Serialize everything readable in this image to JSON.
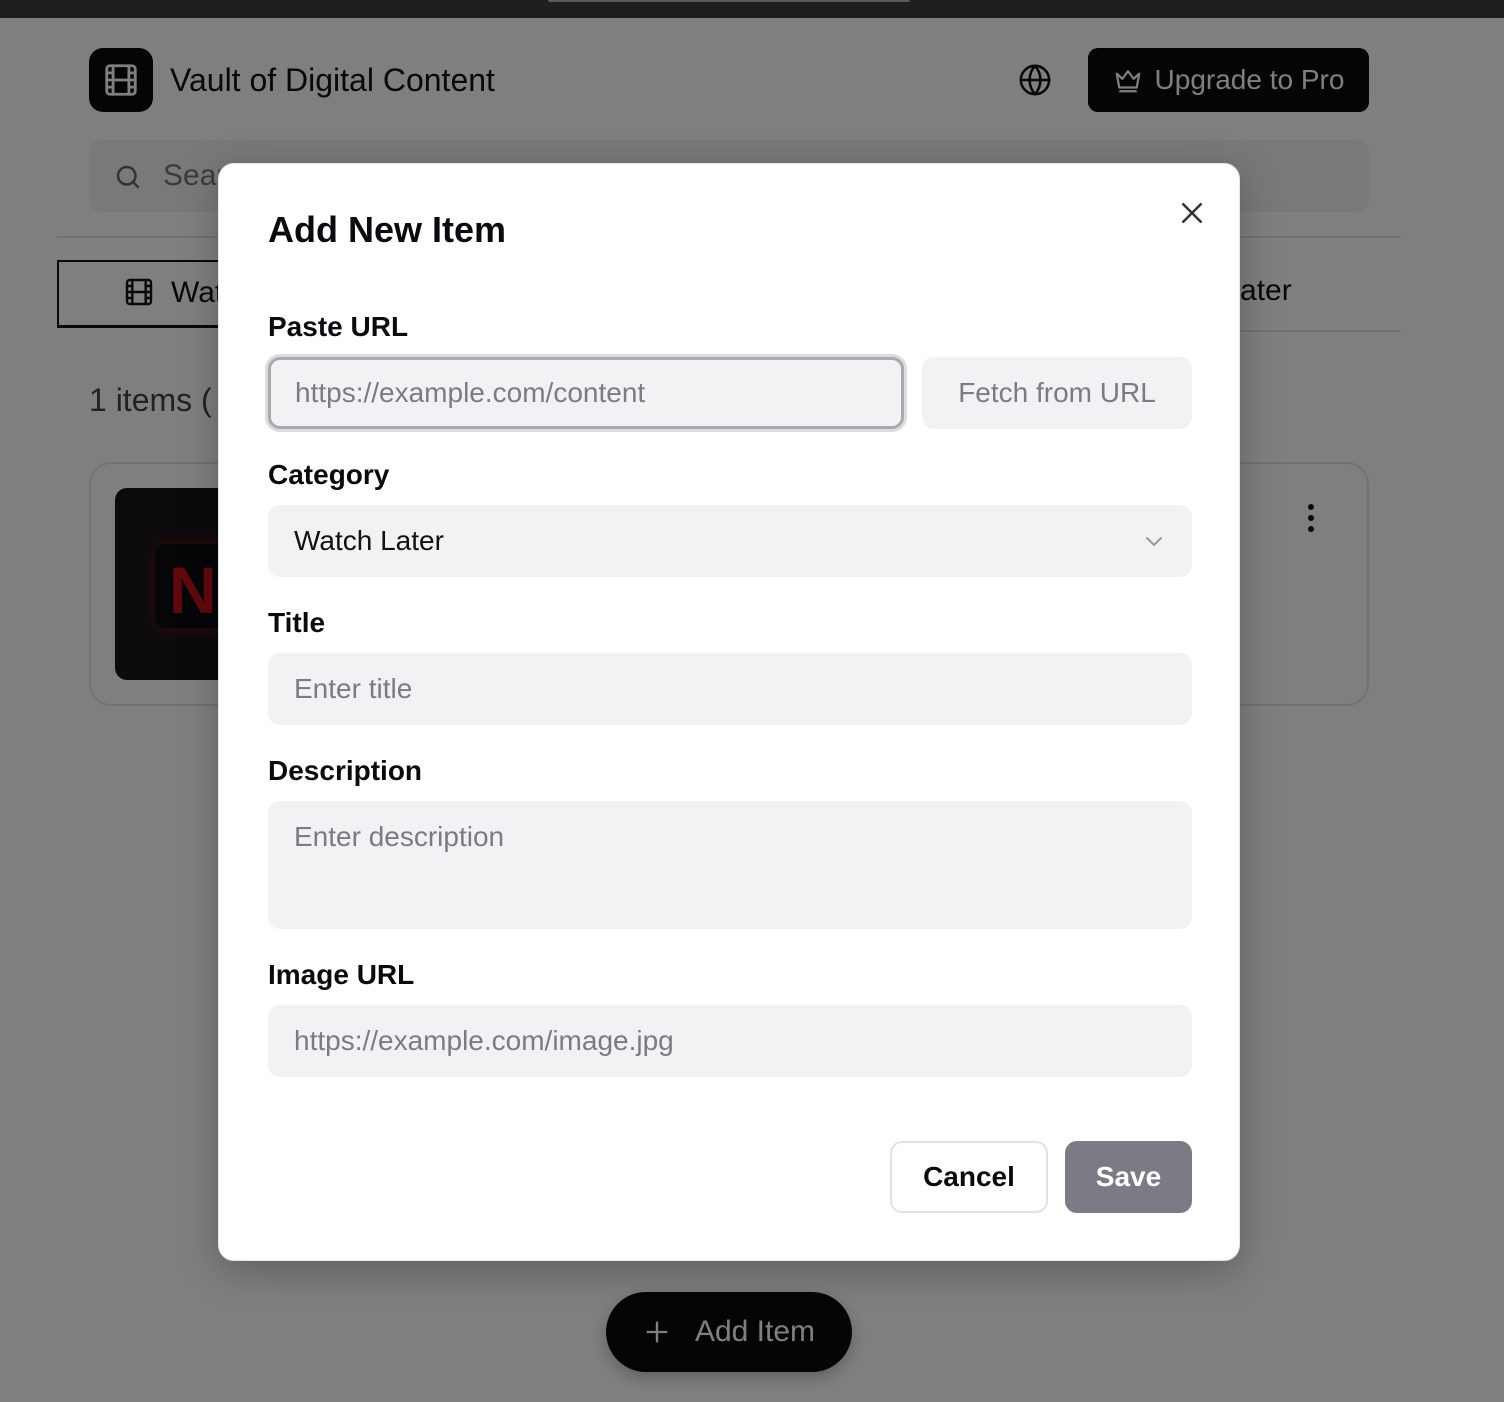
{
  "app": {
    "title": "Vault of Digital Content",
    "upgrade_label": "Upgrade to Pro"
  },
  "search": {
    "placeholder_visible": "Sear"
  },
  "tabs": {
    "active_label_visible": "Wat",
    "right_label_visible": "k Later"
  },
  "list": {
    "count_visible": "1 items  ("
  },
  "fab": {
    "label": "Add Item"
  },
  "modal": {
    "title": "Add New Item",
    "paste_url_label": "Paste URL",
    "url_placeholder": "https://example.com/content",
    "fetch_label": "Fetch from URL",
    "category_label": "Category",
    "category_value": "Watch Later",
    "title_label": "Title",
    "title_placeholder": "Enter title",
    "description_label": "Description",
    "description_placeholder": "Enter description",
    "image_url_label": "Image URL",
    "image_url_placeholder": "https://example.com/image.jpg",
    "cancel_label": "Cancel",
    "save_label": "Save"
  },
  "icons": [
    "film-icon",
    "globe-icon",
    "crown-icon",
    "search-icon",
    "more-vertical-icon",
    "close-icon",
    "chevron-down-icon",
    "plus-icon"
  ],
  "colors": {
    "primary": "#0b0b0f",
    "input_bg": "#f2f2f4",
    "muted": "#7b7b85",
    "overlay": "rgba(0,0,0,0.5)"
  }
}
